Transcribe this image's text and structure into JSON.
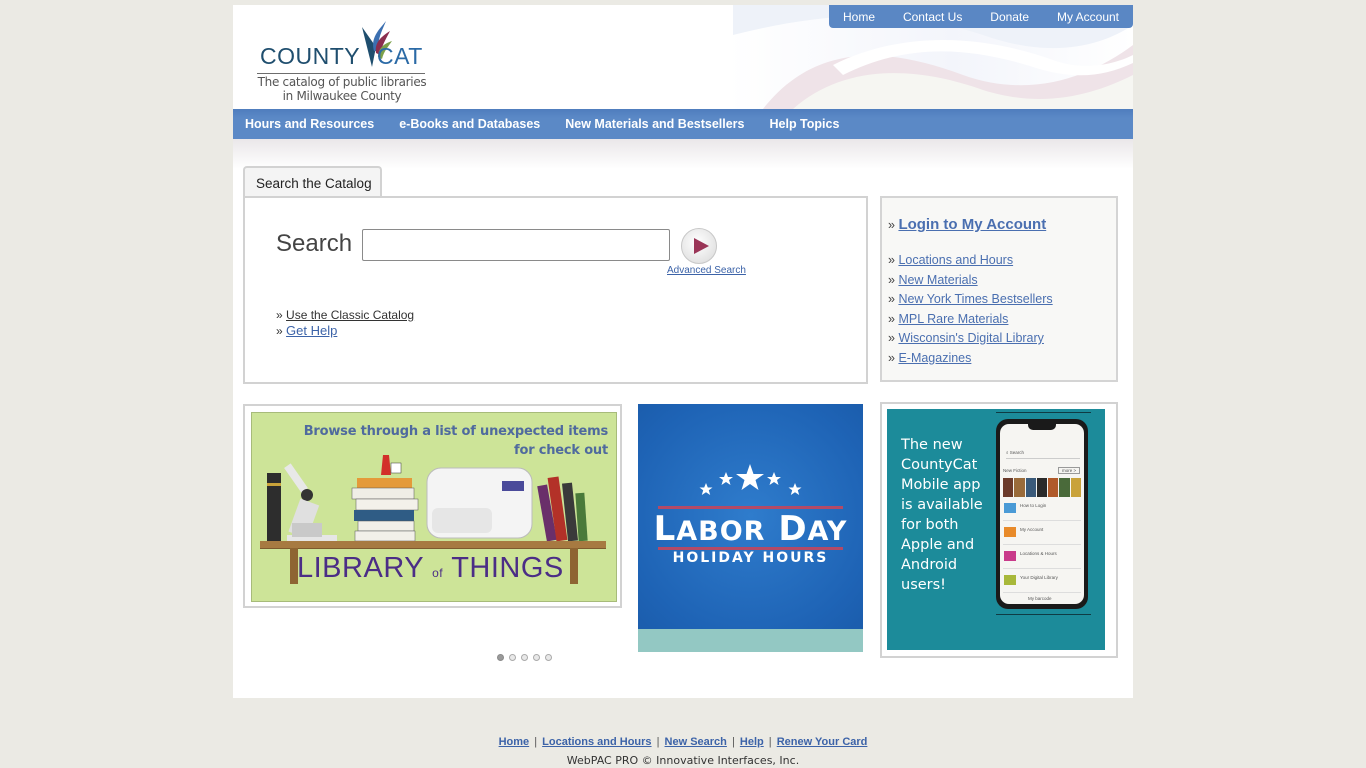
{
  "logo": {
    "word1": "COUNTY",
    "word2": "CAT",
    "tagline_line1": "The catalog of public libraries",
    "tagline_line2": "in Milwaukee County"
  },
  "top_nav": [
    {
      "label": "Home"
    },
    {
      "label": "Contact Us"
    },
    {
      "label": "Donate"
    },
    {
      "label": "My Account"
    }
  ],
  "main_nav": [
    {
      "label": "Hours and Resources"
    },
    {
      "label": "e-Books and Databases"
    },
    {
      "label": "New Materials and Bestsellers"
    },
    {
      "label": "Help Topics"
    }
  ],
  "search": {
    "tab_label": "Search the Catalog",
    "label": "Search",
    "value": "",
    "placeholder": "",
    "submit_label": "Search",
    "advanced_label": "Advanced Search",
    "bullet": "»",
    "links": [
      {
        "label": "Use the Classic Catalog"
      },
      {
        "label": "Get Help"
      }
    ]
  },
  "side_links": {
    "bullet": "»",
    "login": "Login to My Account",
    "items": [
      {
        "label": "Locations and Hours"
      },
      {
        "label": "New Materials"
      },
      {
        "label": "New York Times Bestsellers"
      },
      {
        "label": "MPL Rare Materials"
      },
      {
        "label": "Wisconsin's Digital Library"
      },
      {
        "label": "E-Magazines"
      }
    ]
  },
  "promos": {
    "library_of_things": {
      "caption_line1": "Browse through a list of unexpected items",
      "caption_line2": "for check out",
      "title_left": "LIBRARY",
      "title_mid": "of",
      "title_right": "THINGS"
    },
    "labor_day": {
      "title_l": "L",
      "title_abor": "ABOR",
      "title_d": "D",
      "title_ay": "AY",
      "subtitle": "HOLIDAY HOURS"
    },
    "mobile_app": {
      "lines": [
        "The new",
        "CountyCat",
        "Mobile app",
        "is available",
        "for both",
        "Apple and",
        "Android",
        "users!"
      ],
      "screen": {
        "search": "Search",
        "section": "New Fiction",
        "more": "more >",
        "rows": [
          "How to Login",
          "My Account",
          "Locations & Hours",
          "Your Digital Library"
        ],
        "footer": "My barcode"
      }
    }
  },
  "carousel": {
    "count": 5,
    "active": 1
  },
  "footer": {
    "links": [
      {
        "label": "Home"
      },
      {
        "label": "Locations and Hours"
      },
      {
        "label": "New Search"
      },
      {
        "label": "Help"
      },
      {
        "label": "Renew Your Card"
      }
    ],
    "separator": "|",
    "copyright": "WebPAC PRO © Innovative Interfaces, Inc."
  },
  "colors": {
    "nav_blue": "#5a87c4",
    "link_blue": "#3c63a8",
    "submit_arrow": "#9a3557",
    "app_teal": "#1c8b9a",
    "labor_blue": "#1e63b5"
  }
}
